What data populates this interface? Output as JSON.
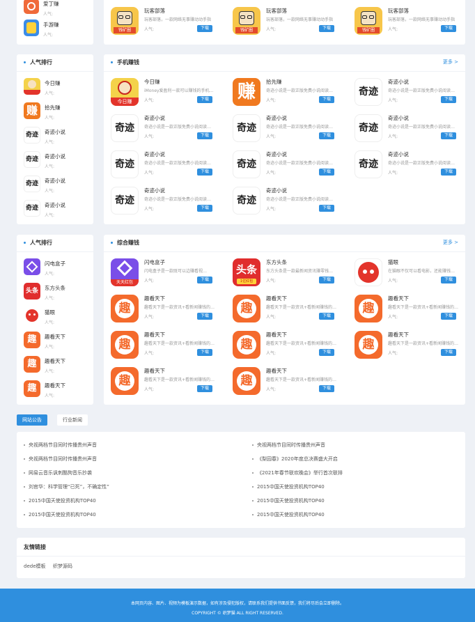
{
  "top_rank": {
    "items": [
      {
        "name": "爱丁赚",
        "pop": "人气:"
      },
      {
        "name": "手游赚",
        "pop": "人气:"
      }
    ]
  },
  "top_apps": [
    {
      "name": "玩客部落",
      "desc": "玩客部落，一款网络无事赚动动手指",
      "pop": "人气:",
      "dl": "下载"
    },
    {
      "name": "玩客部落",
      "desc": "玩客部落，一款网络无事赚动动手指",
      "pop": "人气:",
      "dl": "下载"
    },
    {
      "name": "玩客部落",
      "desc": "玩客部落，一款网络无事赚动动手指",
      "pop": "人气:",
      "dl": "下载"
    }
  ],
  "rank1": {
    "title": "人气排行",
    "items": [
      {
        "name": "今日赚",
        "pop": "人气:"
      },
      {
        "name": "拾先赚",
        "pop": "人气:"
      },
      {
        "name": "奇迹小说",
        "pop": "人气:"
      },
      {
        "name": "奇迹小说",
        "pop": "人气:"
      },
      {
        "name": "奇迹小说",
        "pop": "人气:"
      },
      {
        "name": "奇迹小说",
        "pop": "人气:"
      }
    ]
  },
  "phone": {
    "title": "手机赚钱",
    "more": "更多 >",
    "apps": [
      {
        "name": "今日赚",
        "desc": "iMoney爱盈利一款可以赚钱的手机…",
        "pop": "人气:",
        "dl": "下载"
      },
      {
        "name": "拾先赚",
        "desc": "奇迹小说是一款正版免费小说阅读…",
        "pop": "人气:",
        "dl": "下载"
      },
      {
        "name": "奇迹小说",
        "desc": "奇迹小说是一款正版免费小说阅读…",
        "pop": "人气:",
        "dl": "下载"
      },
      {
        "name": "奇迹小说",
        "desc": "奇迹小说是一款正版免费小说阅读…",
        "pop": "人气:",
        "dl": "下载"
      },
      {
        "name": "奇迹小说",
        "desc": "奇迹小说是一款正版免费小说阅读…",
        "pop": "人气:",
        "dl": "下载"
      },
      {
        "name": "奇迹小说",
        "desc": "奇迹小说是一款正版免费小说阅读…",
        "pop": "人气:",
        "dl": "下载"
      },
      {
        "name": "奇迹小说",
        "desc": "奇迹小说是一款正版免费小说阅读…",
        "pop": "人气:",
        "dl": "下载"
      },
      {
        "name": "奇迹小说",
        "desc": "奇迹小说是一款正版免费小说阅读…",
        "pop": "人气:",
        "dl": "下载"
      },
      {
        "name": "奇迹小说",
        "desc": "奇迹小说是一款正版免费小说阅读…",
        "pop": "人气:",
        "dl": "下载"
      },
      {
        "name": "奇迹小说",
        "desc": "奇迹小说是一款正版免费小说阅读…",
        "pop": "人气:",
        "dl": "下载"
      },
      {
        "name": "奇迹小说",
        "desc": "奇迹小说是一款正版免费小说阅读…",
        "pop": "人气:",
        "dl": "下载"
      }
    ]
  },
  "rank2": {
    "title": "人气排行",
    "items": [
      {
        "name": "闪电盒子",
        "pop": "人气:"
      },
      {
        "name": "东方头条",
        "pop": "人气:"
      },
      {
        "name": "猫眼",
        "pop": "人气:"
      },
      {
        "name": "趣看天下",
        "pop": "人气:"
      },
      {
        "name": "趣看天下",
        "pop": "人气:"
      },
      {
        "name": "趣看天下",
        "pop": "人气:"
      }
    ]
  },
  "general": {
    "title": "综合赚钱",
    "more": "更多 >",
    "apps": [
      {
        "name": "闪电盒子",
        "desc": "闪电盒子是一款既可以边赚看视…",
        "pop": "人气:",
        "dl": "下载"
      },
      {
        "name": "东方头条",
        "desc": "东方头条是一款最新闻资讯赚零钱…",
        "pop": "人气:",
        "dl": "下载"
      },
      {
        "name": "猫眼",
        "desc": "在猫眼不仅可以看电影，还能赚钱…",
        "pop": "人气:",
        "dl": "下载"
      },
      {
        "name": "趣看天下",
        "desc": "趣看天下是一款资讯+看新闻赚钱的…",
        "pop": "人气:",
        "dl": "下载"
      },
      {
        "name": "趣看天下",
        "desc": "趣看天下是一款资讯+看新闻赚钱的…",
        "pop": "人气:",
        "dl": "下载"
      },
      {
        "name": "趣看天下",
        "desc": "趣看天下是一款资讯+看新闻赚钱的…",
        "pop": "人气:",
        "dl": "下载"
      },
      {
        "name": "趣看天下",
        "desc": "趣看天下是一款资讯+看新闻赚钱的…",
        "pop": "人气:",
        "dl": "下载"
      },
      {
        "name": "趣看天下",
        "desc": "趣看天下是一款资讯+看新闻赚钱的…",
        "pop": "人气:",
        "dl": "下载"
      },
      {
        "name": "趣看天下",
        "desc": "趣看天下是一款资讯+看新闻赚钱的…",
        "pop": "人气:",
        "dl": "下载"
      },
      {
        "name": "趣看天下",
        "desc": "趣看天下是一款资讯+看新闻赚钱的…",
        "pop": "人气:",
        "dl": "下载"
      },
      {
        "name": "趣看天下",
        "desc": "趣看天下是一款资讯+看新闻赚钱的…",
        "pop": "人气:",
        "dl": "下载"
      }
    ]
  },
  "news": {
    "tab_active": "网站公告",
    "tab_other": "行业新闻",
    "left": [
      "央视两档节目同时传播贵州声音",
      "央视两档节目同时传播贵州声音",
      "网易云音乐讽刺酷狗音乐抄袭",
      "刘官华：科学管理“已死”，不确定性”",
      "2015中国天使投资机构TOP40",
      "2015中国天使投资机构TOP40"
    ],
    "right": [
      "央视两档节目同时传播贵州声音",
      "《梨园春》2020年度总决赛盛大开启",
      "《2021年春节联欢晚会》举行首次联排",
      "2015中国天使投资机构TOP40",
      "2015中国天使投资机构TOP40",
      "2015中国天使投资机构TOP40"
    ]
  },
  "links": {
    "title": "友情链接",
    "items": [
      "dede模板",
      "织梦源码"
    ]
  },
  "footer": {
    "line1": "本网页内容、图片、视频为模板演示数据，如有涉及侵犯版权，请联系我们提供书面反馈，我们将尽后会立即删除。",
    "line2": "COPYRIGHT © 织梦猫 ALL RIGHT RESERVED."
  },
  "icon_texts": {
    "wanke_banner": "钱矿圈",
    "jinri_banner": "今日赚",
    "zhuan": "赚",
    "qiji": "奇迹",
    "shandian_banner": "天天红包",
    "toutiao": "头条",
    "toutiao_sub": "1亿红包",
    "qu": "趣"
  },
  "colors": {
    "accent": "#2f8fde",
    "bg": "#eef1f6"
  }
}
